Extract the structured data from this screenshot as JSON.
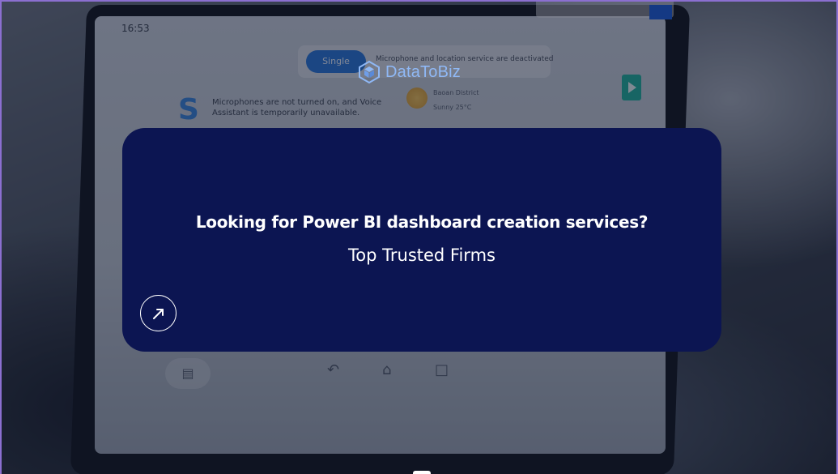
{
  "background_screen": {
    "clock": "16:53",
    "mode_button": "Single",
    "notice": "Microphone and location service are deactivated",
    "mic_message_line1": "Microphones are not turned on, and Voice",
    "mic_message_line2": "Assistant is temporarily unavailable.",
    "weather_location": "Baoan District",
    "weather_condition": "Sunny 25°C",
    "icons": [
      "car-icon",
      "back-icon",
      "home-icon",
      "recent-apps-icon",
      "play-icon"
    ]
  },
  "brand": {
    "name": "DataToBiz",
    "color": "#8fb8f5"
  },
  "card": {
    "title": "Looking for Power BI dashboard creation services?",
    "subtitle": "Top Trusted Firms",
    "background": "#0c1552",
    "button_icon": "arrow-up-right-icon"
  },
  "colors": {
    "accent_border": "#8b6fd0",
    "mode_button": "#2b78d6"
  }
}
